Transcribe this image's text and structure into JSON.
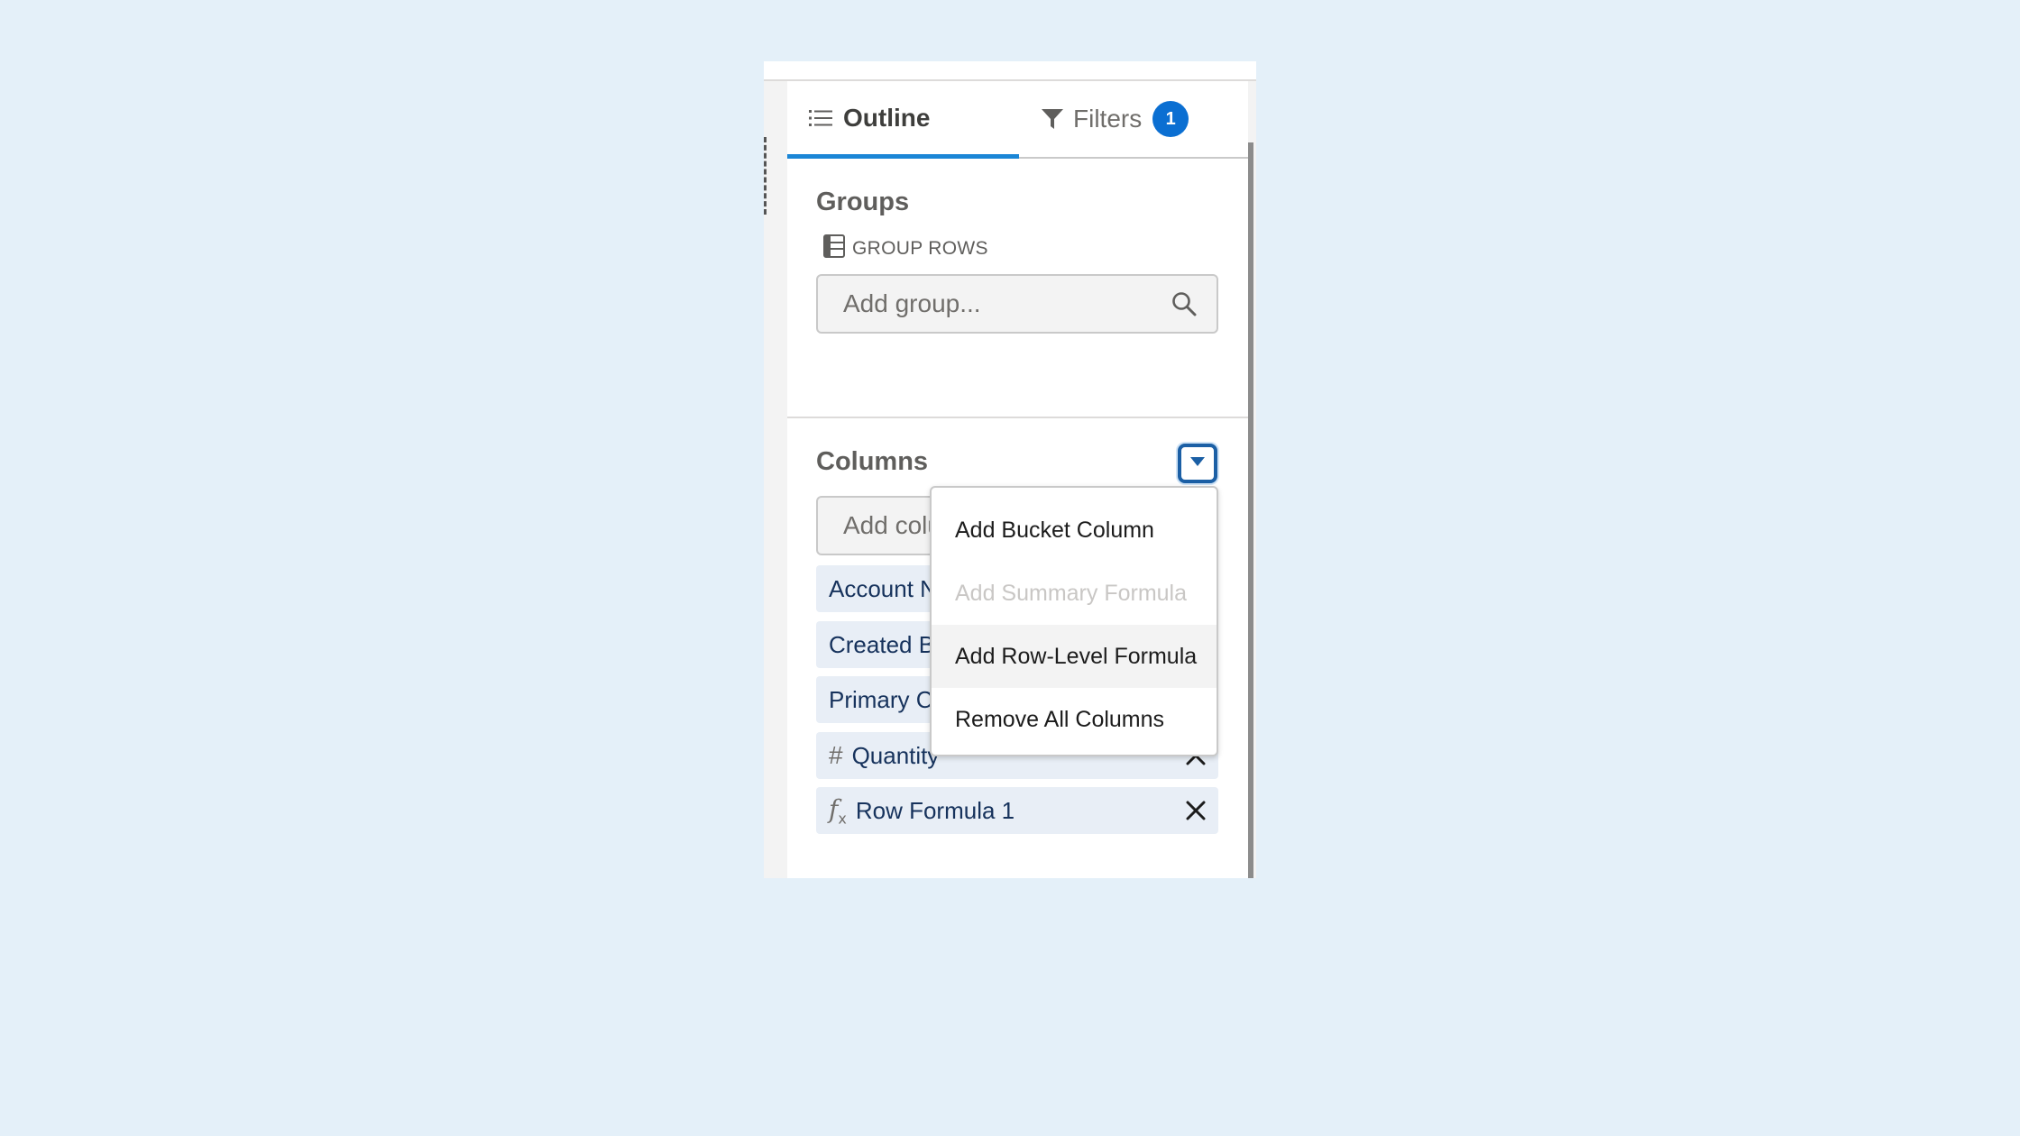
{
  "tabs": {
    "outline_label": "Outline",
    "filters_label": "Filters",
    "filters_count": "1"
  },
  "groups": {
    "title": "Groups",
    "group_rows_label": "GROUP ROWS",
    "search_placeholder": "Add group..."
  },
  "columns": {
    "title": "Columns",
    "search_placeholder": "Add column...",
    "items": [
      {
        "label": "Account Name",
        "type": "text"
      },
      {
        "label": "Created By",
        "type": "text"
      },
      {
        "label": "Primary Contact",
        "type": "text"
      },
      {
        "label": "Quantity",
        "type": "number",
        "icon": "#"
      },
      {
        "label": "Row Formula 1",
        "type": "formula"
      }
    ]
  },
  "menu": {
    "items": [
      {
        "label": "Add Bucket Column",
        "enabled": true
      },
      {
        "label": "Add Summary Formula",
        "enabled": false
      },
      {
        "label": "Add Row-Level Formula",
        "enabled": true,
        "hovered": true
      },
      {
        "label": "Remove All Columns",
        "enabled": true
      }
    ]
  },
  "colors": {
    "accent": "#1b86d6",
    "badge": "#0b6fd2",
    "pill_bg": "#e8eef6",
    "pill_text": "#16325c"
  }
}
